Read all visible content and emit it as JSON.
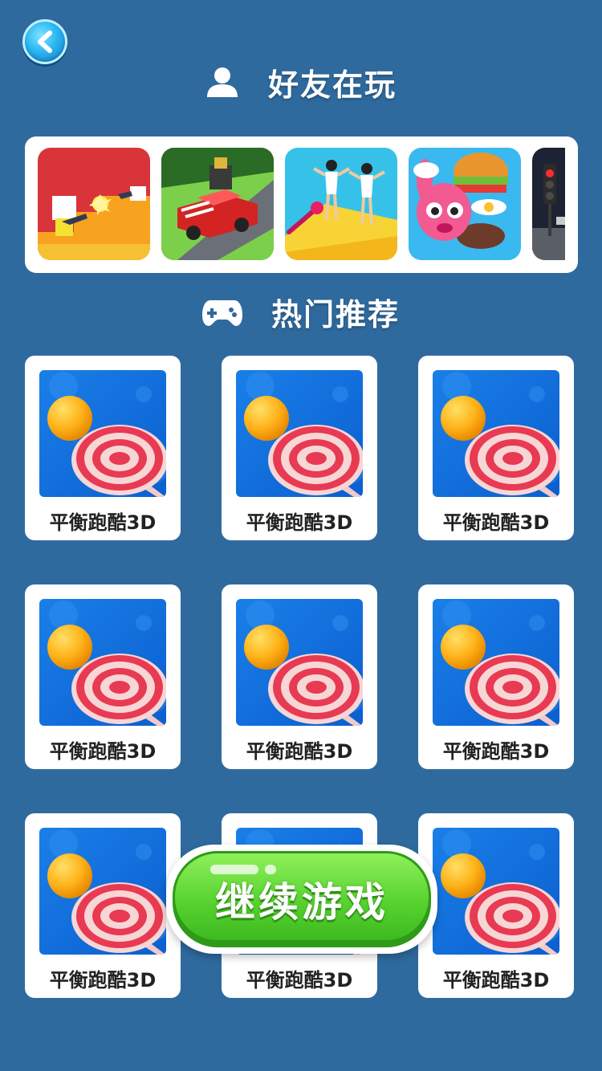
{
  "header": {
    "back_icon": "back-arrow-icon",
    "accent": "#2bb7f2"
  },
  "friends_section": {
    "title": "好友在玩",
    "icon": "person-icon",
    "games": [
      {
        "icon": "shooter-game-icon"
      },
      {
        "icon": "car-turret-game-icon"
      },
      {
        "icon": "dancer-runner-game-icon"
      },
      {
        "icon": "burger-bunny-game-icon"
      },
      {
        "icon": "traffic-light-game-icon"
      }
    ]
  },
  "hot_section": {
    "title": "热门推荐",
    "icon": "gamepad-icon",
    "games": [
      {
        "label": "平衡跑酷3D"
      },
      {
        "label": "平衡跑酷3D"
      },
      {
        "label": "平衡跑酷3D"
      },
      {
        "label": "平衡跑酷3D"
      },
      {
        "label": "平衡跑酷3D"
      },
      {
        "label": "平衡跑酷3D"
      },
      {
        "label": "平衡跑酷3D"
      },
      {
        "label": "平衡跑酷3D"
      },
      {
        "label": "平衡跑酷3D"
      }
    ]
  },
  "continue_button": {
    "label": "继续游戏",
    "color": "#56d22f"
  },
  "colors": {
    "background": "#2f6a9e",
    "card": "#ffffff"
  }
}
